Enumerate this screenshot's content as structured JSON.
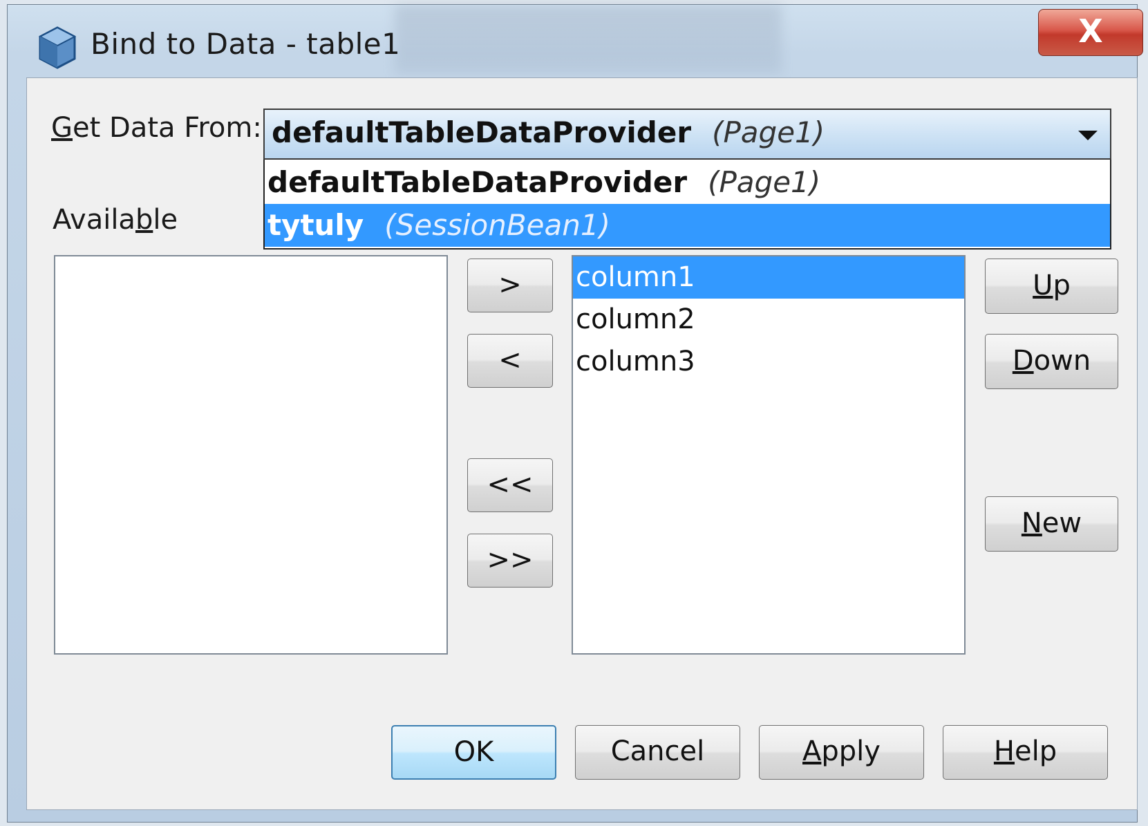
{
  "window": {
    "title": "Bind to Data - table1",
    "close_label": "X"
  },
  "get_data_from": {
    "label_underlined": "G",
    "label_rest": "et Data From:",
    "selected_name": "defaultTableDataProvider",
    "selected_scope": "(Page1)",
    "options": [
      {
        "name": "defaultTableDataProvider",
        "scope": "(Page1)"
      },
      {
        "name": "tytuly",
        "scope": "(SessionBean1)"
      }
    ]
  },
  "available": {
    "label_pre": "Availa",
    "label_underlined": "b",
    "label_post": "le",
    "items": []
  },
  "selected_columns": {
    "items": [
      "column1",
      "column2",
      "column3"
    ],
    "selected_index": 0
  },
  "transfer_buttons": {
    "add": ">",
    "remove": "<",
    "remove_all": "<<",
    "add_all": ">>"
  },
  "side_buttons": {
    "up_underlined": "U",
    "up_rest": "p",
    "down_underlined": "D",
    "down_rest": "own",
    "new_underlined": "N",
    "new_rest": "ew"
  },
  "footer": {
    "ok": "OK",
    "cancel": "Cancel",
    "apply_underlined": "A",
    "apply_rest": "pply",
    "help_underlined": "H",
    "help_rest": "elp"
  },
  "colors": {
    "selection": "#3399ff",
    "close_button": "#c2392b"
  }
}
